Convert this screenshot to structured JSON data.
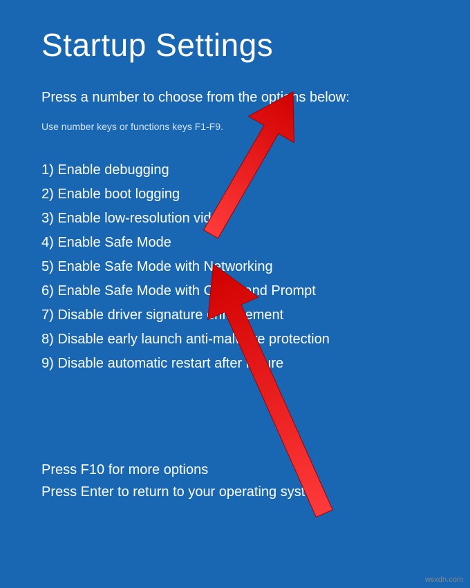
{
  "title": "Startup Settings",
  "subtitle": "Press a number to choose from the options below:",
  "hint": "Use number keys or functions keys F1-F9.",
  "options": [
    "1) Enable debugging",
    "2) Enable boot logging",
    "3) Enable low-resolution video",
    "4) Enable Safe Mode",
    "5) Enable Safe Mode with Networking",
    "6) Enable Safe Mode with Command Prompt",
    "7) Disable driver signature enforcement",
    "8) Disable early launch anti-malware protection",
    "9) Disable automatic restart after failure"
  ],
  "footer": {
    "line1": "Press F10 for more options",
    "line2": "Press Enter to return to your operating system"
  },
  "watermark": "wsxdn.com"
}
